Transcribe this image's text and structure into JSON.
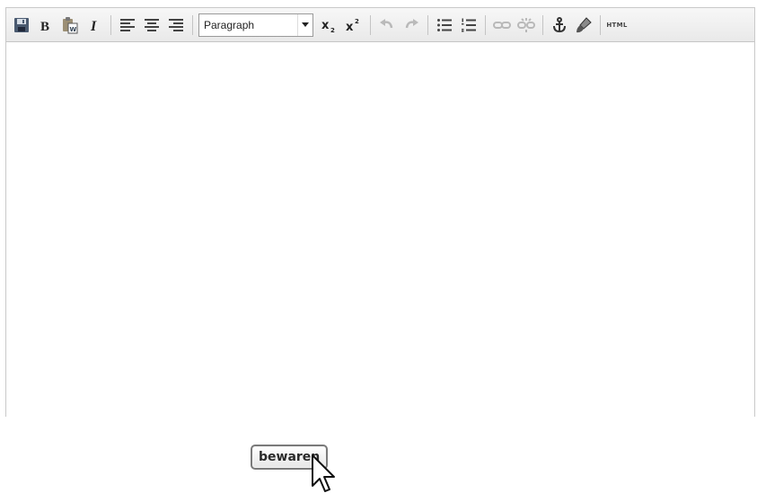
{
  "toolbar": {
    "format_select": {
      "value": "Paragraph"
    },
    "html_button_label": "HTML",
    "buttons": [
      {
        "icon": "save-icon"
      },
      {
        "icon": "bold-icon"
      },
      {
        "icon": "paste-from-word-icon"
      },
      {
        "icon": "italic-icon"
      },
      {
        "icon": "align-left-icon"
      },
      {
        "icon": "align-center-icon"
      },
      {
        "icon": "align-right-icon"
      },
      {
        "icon": "subscript-icon"
      },
      {
        "icon": "superscript-icon"
      },
      {
        "icon": "undo-icon",
        "disabled": true
      },
      {
        "icon": "redo-icon",
        "disabled": true
      },
      {
        "icon": "bullet-list-icon"
      },
      {
        "icon": "numbered-list-icon"
      },
      {
        "icon": "link-icon",
        "disabled": true
      },
      {
        "icon": "unlink-icon",
        "disabled": true
      },
      {
        "icon": "anchor-icon"
      },
      {
        "icon": "cleanup-brush-icon"
      },
      {
        "icon": "html-source-icon"
      }
    ]
  },
  "editor": {
    "content": ""
  },
  "save_button": {
    "label": "bewaren"
  },
  "cursor": {
    "icon": "mouse-pointer-icon"
  },
  "colors": {
    "toolbar_bg": "#eeeeee",
    "border": "#c9c9c9",
    "disabled_icon": "#bbbbbb"
  }
}
